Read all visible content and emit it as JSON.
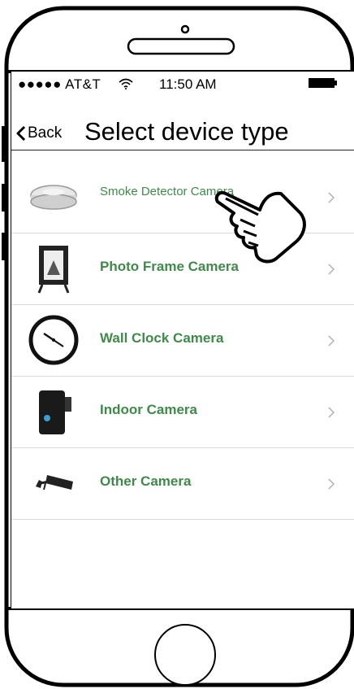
{
  "status": {
    "carrier": "●●●●● AT&T",
    "time": "11:50  AM"
  },
  "nav": {
    "back_label": "Back",
    "title": "Select device type"
  },
  "devices": [
    {
      "label": "Smoke Detector Camera",
      "icon": "smoke-detector-icon"
    },
    {
      "label": "Photo Frame Camera",
      "icon": "photo-frame-icon"
    },
    {
      "label": "Wall Clock Camera",
      "icon": "wall-clock-icon"
    },
    {
      "label": "Indoor Camera",
      "icon": "indoor-camera-icon"
    },
    {
      "label": "Other Camera",
      "icon": "security-camera-icon"
    }
  ],
  "colors": {
    "label_green": "#3f8a4a",
    "chevron_gray": "#b0b0b0"
  }
}
